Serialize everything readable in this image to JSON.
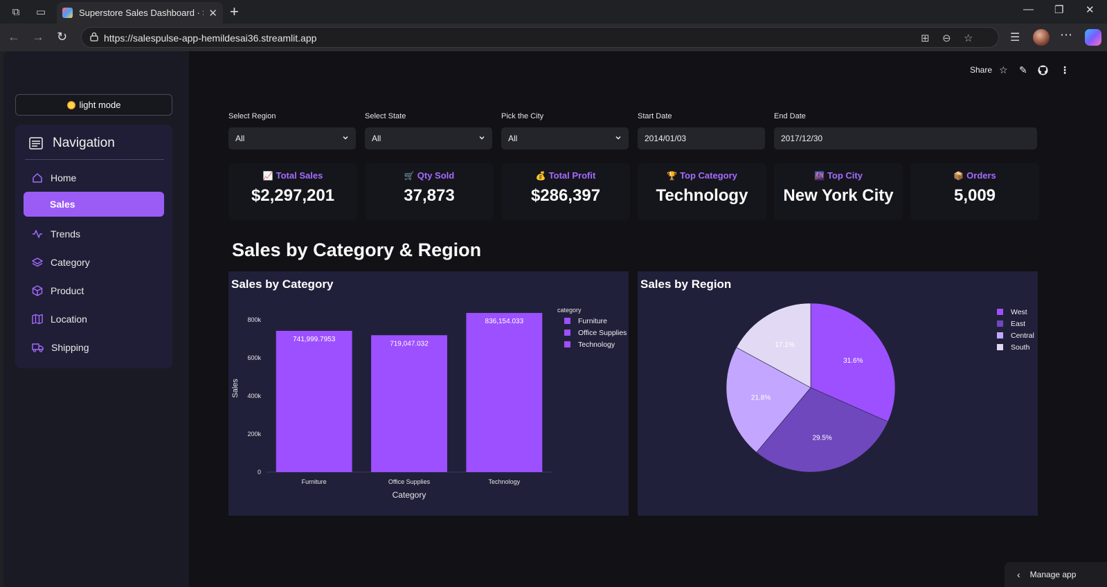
{
  "browser": {
    "tab_title": "Superstore Sales Dashboard · Stre",
    "url": "https://salespulse-app-hemildesai36.streamlit.app"
  },
  "sidebar": {
    "theme_button": "light mode",
    "nav_title": "Navigation",
    "items": [
      {
        "label": "Home",
        "icon": "home-icon"
      },
      {
        "label": "Sales",
        "icon": "",
        "active": true
      },
      {
        "label": "Trends",
        "icon": "activity-icon"
      },
      {
        "label": "Category",
        "icon": "layers-icon"
      },
      {
        "label": "Product",
        "icon": "box-icon"
      },
      {
        "label": "Location",
        "icon": "map-icon"
      },
      {
        "label": "Shipping",
        "icon": "truck-icon"
      }
    ]
  },
  "toolbar": {
    "share": "Share"
  },
  "filters": [
    {
      "label": "Select Region",
      "value": "All",
      "dropdown": true
    },
    {
      "label": "Select State",
      "value": "All",
      "dropdown": true
    },
    {
      "label": "Pick the City",
      "value": "All",
      "dropdown": true
    },
    {
      "label": "Start Date",
      "value": "2014/01/03",
      "dropdown": false
    },
    {
      "label": "End Date",
      "value": "2017/12/30",
      "dropdown": false
    }
  ],
  "kpis": [
    {
      "label": "Total Sales",
      "emoji": "📈",
      "value": "$2,297,201"
    },
    {
      "label": "Qty Sold",
      "emoji": "🛒",
      "value": "37,873"
    },
    {
      "label": "Total Profit",
      "emoji": "💰",
      "value": "$286,397"
    },
    {
      "label": "Top Category",
      "emoji": "🏆",
      "value": "Technology"
    },
    {
      "label": "Top City",
      "emoji": "🌆",
      "value": "New York City"
    },
    {
      "label": "Orders",
      "emoji": "📦",
      "value": "5,009"
    }
  ],
  "section_title": "Sales by Category & Region",
  "manage_app": "Manage app",
  "colors": {
    "accent": "#9b5cf6",
    "card_bg": "#21203a"
  },
  "chart_data": [
    {
      "type": "bar",
      "title": "Sales by Category",
      "xlabel": "Category",
      "ylabel": "Sales",
      "categories": [
        "Furniture",
        "Office Supplies",
        "Technology"
      ],
      "values": [
        741999.7953,
        719047.032,
        836154.033
      ],
      "value_labels": [
        "741,999.7953",
        "719,047.032",
        "836,154.033"
      ],
      "yticks": [
        0,
        200000,
        400000,
        600000,
        800000
      ],
      "ytick_labels": [
        "0",
        "200k",
        "400k",
        "600k",
        "800k"
      ],
      "ylim": [
        0,
        880000
      ],
      "legend_title": "category",
      "legend": [
        "Furniture",
        "Office Supplies",
        "Technology"
      ],
      "legend_position": "top-right",
      "color": "#9d50ff"
    },
    {
      "type": "pie",
      "title": "Sales by Region",
      "labels": [
        "West",
        "East",
        "Central",
        "South"
      ],
      "values": [
        31.6,
        29.5,
        21.8,
        17.1
      ],
      "value_labels": [
        "31.6%",
        "29.5%",
        "21.8%",
        "17.1%"
      ],
      "colors": [
        "#9d50ff",
        "#6f48bd",
        "#c3a6ff",
        "#e2daf4"
      ],
      "legend_position": "top-right"
    }
  ]
}
